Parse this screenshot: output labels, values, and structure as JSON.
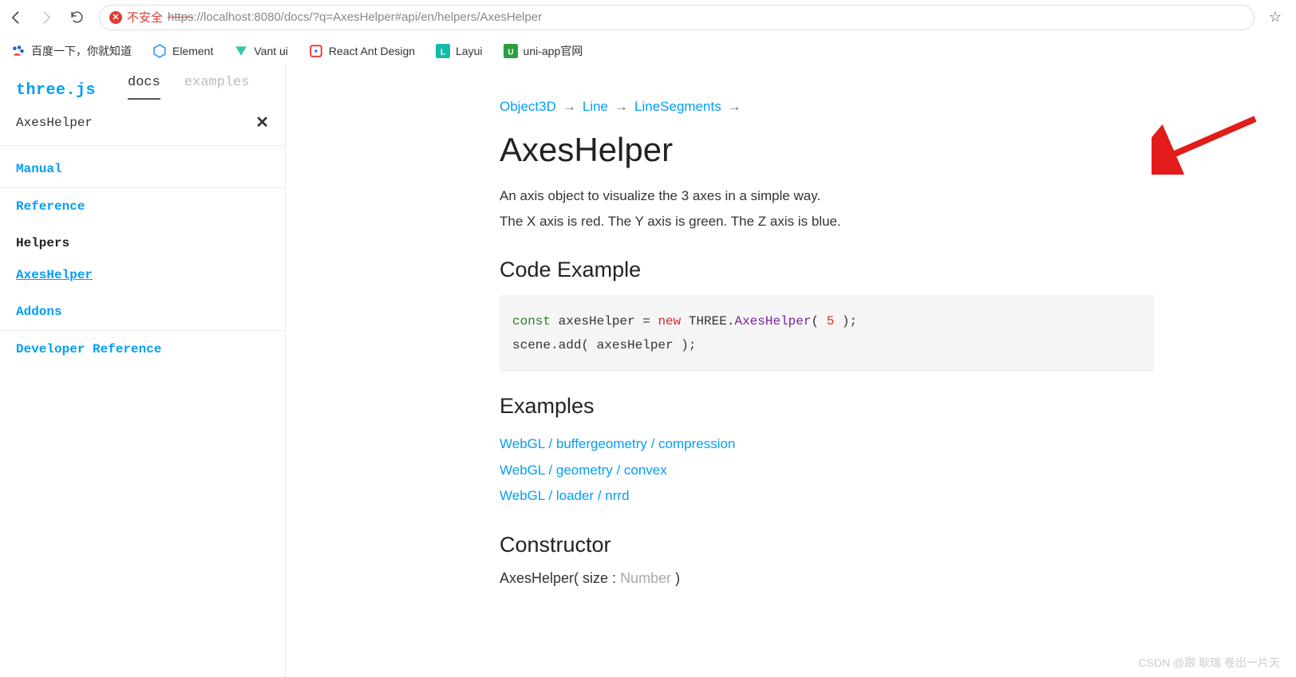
{
  "browser": {
    "danger_label": "不安全",
    "url_scheme": "https",
    "url_rest": "://localhost:8080/docs/?q=AxesHelper#api/en/helpers/AxesHelper"
  },
  "bookmarks": [
    {
      "label": "百度一下，你就知道",
      "color": "#2a5bd7"
    },
    {
      "label": "Element",
      "color": "#409eff"
    },
    {
      "label": "Vant ui",
      "color": "#07c160"
    },
    {
      "label": "React Ant Design",
      "color": "#f5222d"
    },
    {
      "label": "Layui",
      "color": "#16baaa"
    },
    {
      "label": "uni-app官网",
      "color": "#42b983"
    }
  ],
  "sidebar": {
    "brand": "three.js",
    "tabs": {
      "docs": "docs",
      "examples": "examples"
    },
    "search_value": "AxesHelper",
    "nav": {
      "manual": "Manual",
      "reference": "Reference",
      "helpers": "Helpers",
      "axes_helper": "AxesHelper",
      "addons": "Addons",
      "dev_ref": "Developer Reference"
    }
  },
  "content": {
    "breadcrumb": [
      "Object3D",
      "Line",
      "LineSegments"
    ],
    "title": "AxesHelper",
    "desc_line1": "An axis object to visualize the 3 axes in a simple way.",
    "desc_line2": "The X axis is red. The Y axis is green. The Z axis is blue.",
    "code_heading": "Code Example",
    "code": {
      "const": "const",
      "var1": " axesHelper = ",
      "new": "new",
      "three": " THREE.",
      "cls": "AxesHelper",
      "open": "( ",
      "arg": "5",
      "close": " );",
      "line2": "scene.add( axesHelper );"
    },
    "examples_heading": "Examples",
    "example_links": [
      "WebGL / buffergeometry / compression",
      "WebGL / geometry / convex",
      "WebGL / loader / nrrd"
    ],
    "ctor_heading": "Constructor",
    "ctor_sig_pre": "AxesHelper( size : ",
    "ctor_sig_type": "Number",
    "ctor_sig_post": " )"
  },
  "watermark": "CSDN @跟 耿瑞 卷出一片天"
}
